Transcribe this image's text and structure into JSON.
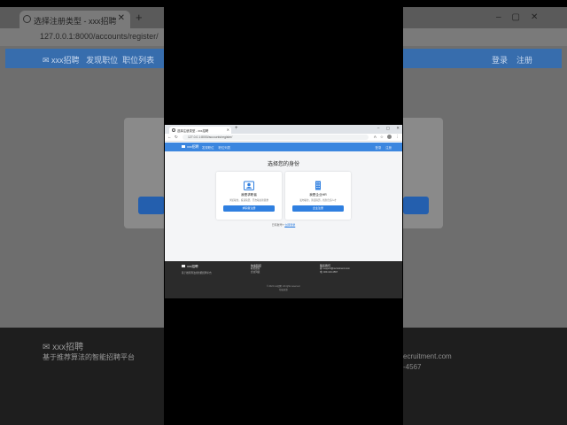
{
  "bg": {
    "tab_title": "选择注册类型 - xxx招聘",
    "url": "127.0.0.1:8000/accounts/register/",
    "brand": "xxx招聘",
    "nav": [
      "发现职位",
      "职位列表"
    ],
    "nav_right": [
      "登录",
      "注册"
    ],
    "footer_brand": "xxx招聘",
    "footer_desc": "基于推荐算法的智能招聘平台",
    "footer_email": "ecruitment.com",
    "footer_phone": "-4567"
  },
  "browser": {
    "tab_title": "选择注册类型 - xxx招聘",
    "url": "127.0.0.1:8000/accounts/register/"
  },
  "nav": {
    "brand": "xxx招聘",
    "links": [
      "发现职位",
      "职位列表"
    ],
    "right": [
      "登录",
      "注册"
    ]
  },
  "main": {
    "title": "选择您的身份",
    "cards": [
      {
        "title": "我是求职者",
        "desc": "浏览职位，投递简历，开启职业新篇章",
        "button": "求职者注册",
        "icon": "id-card-icon"
      },
      {
        "title": "我是企业HR",
        "desc": "发布职位，筛选简历，找到合适人才",
        "button": "企业注册",
        "icon": "building-icon"
      }
    ],
    "login_prompt": "已有账号?",
    "login_link": "立即登录"
  },
  "footer": {
    "brand": "xxx招聘",
    "desc": "基于推荐算法的智能招聘平台",
    "links_title": "快速链接",
    "links": [
      "职位搜索",
      "企业列表"
    ],
    "contact_title": "联系我们",
    "email": "邮: support@recruitment.com",
    "phone": "电: 400-123-4567",
    "copyright": "© 2024 xxx招聘. All rights reserved.",
    "copyright2": "隐私政策"
  },
  "colors": {
    "accent": "#3b86df",
    "button": "#2f7fe0",
    "footer": "#2b2b2b"
  }
}
